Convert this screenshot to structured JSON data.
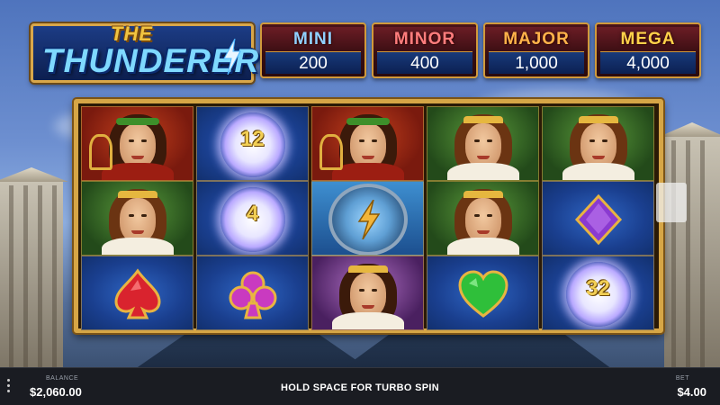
{
  "logo": {
    "line1": "THE",
    "line2": "THUNDERER"
  },
  "jackpots": [
    {
      "label": "MINI",
      "value": "200",
      "color": "#8fd0ff"
    },
    {
      "label": "MINOR",
      "value": "400",
      "color": "#ff7d7d"
    },
    {
      "label": "MAJOR",
      "value": "1,000",
      "color": "#ffb34a"
    },
    {
      "label": "MEGA",
      "value": "4,000",
      "color": "#ffd24a"
    }
  ],
  "reels": {
    "columns": [
      [
        "apollo",
        "hera",
        "spade-gem"
      ],
      [
        "orb",
        "orb",
        "club-gem"
      ],
      [
        "apollo",
        "zeus-shield",
        "athena"
      ],
      [
        "hera",
        "hera",
        "heart-gem"
      ],
      [
        "hera",
        "diamond-gem",
        "orb"
      ]
    ],
    "orb_values": {
      "1-0": "12",
      "1-1": "4",
      "4-2": "32"
    }
  },
  "footer": {
    "balance_label": "BALANCE",
    "balance_value": "$2,060.00",
    "hint": "HOLD SPACE FOR TURBO SPIN",
    "bet_label": "BET",
    "bet_value": "$4.00"
  }
}
